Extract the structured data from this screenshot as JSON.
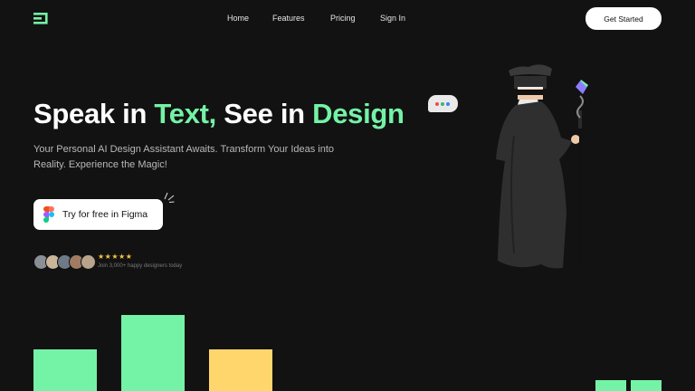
{
  "header": {
    "logo_icon": "stacked-lines-logo-icon",
    "nav": {
      "home": "Home",
      "features": "Features",
      "pricing": "Pricing",
      "signin": "Sign In"
    },
    "cta_label": "Get Started"
  },
  "hero": {
    "headline_part1": "Speak in ",
    "headline_part2": "Text,",
    "headline_part3": " See in ",
    "headline_part4": "Design",
    "subtitle": "Your Personal AI Design Assistant Awaits. Transform Your Ideas into Reality. Experience the Magic!",
    "cta_label": "Try for free in Figma",
    "cta_icon": "figma-icon",
    "stars": "★★★★★",
    "social_note": "Join 3,000+ happy designers today"
  },
  "colors": {
    "background": "#121212",
    "accent_green": "#74f2a6",
    "accent_yellow": "#ffd66b",
    "star": "#f6c342"
  }
}
